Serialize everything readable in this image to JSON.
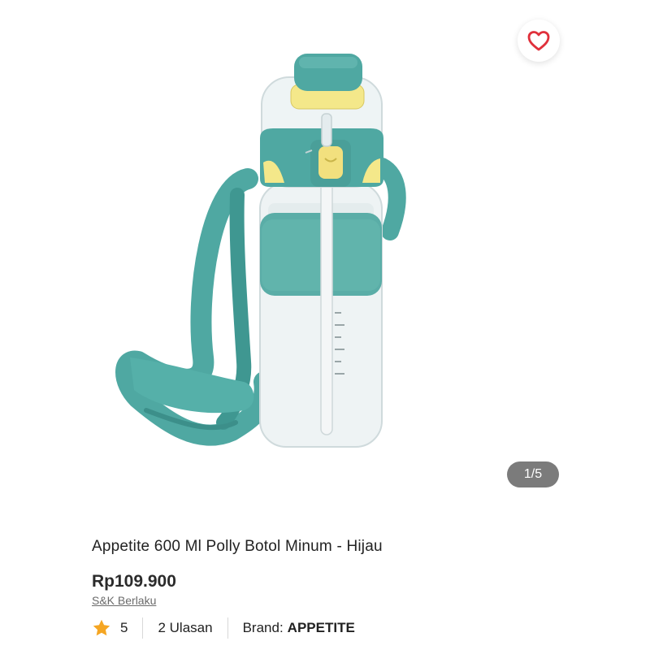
{
  "product": {
    "title": "Appetite 600 Ml Polly Botol Minum - Hijau",
    "price": "Rp109.900",
    "tnc_link": "S&K Berlaku",
    "rating": "5",
    "reviews": "2 Ulasan",
    "brand_label": "Brand:",
    "brand_name": "APPETITE"
  },
  "gallery": {
    "pager": "1/5"
  },
  "icons": {
    "wishlist": "heart-outline-icon",
    "rating": "star-icon"
  },
  "colors": {
    "heart": "#e0303b",
    "star": "#f5a623",
    "bottle_accent": "#4fa8a2",
    "lid_yellow": "#f4e88a",
    "pager_bg": "#7b7b7b"
  }
}
